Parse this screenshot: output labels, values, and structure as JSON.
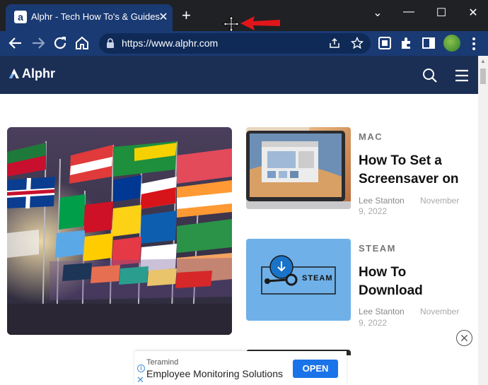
{
  "browser": {
    "tab_title": "Alphr - Tech How To's & Guides",
    "tab_favicon": "a",
    "tab_close": "✕",
    "new_tab": "+",
    "url_host": "https://www.alphr.com",
    "window_controls": {
      "minimize": "—",
      "maximize": "☐",
      "close": "✕",
      "tab_search": "⌄"
    },
    "icons": [
      "back-arrow-icon",
      "forward-arrow-icon",
      "reload-icon",
      "home-icon",
      "lock-icon",
      "share-icon",
      "star-icon",
      "screenshot-icon",
      "extensions-icon",
      "sidepanel-icon",
      "profile-avatar",
      "kebab-menu-icon",
      "move-cursor-icon",
      "red-arrow-annotation"
    ],
    "accent_color": "#1a3a73"
  },
  "site": {
    "logo": "Alphr",
    "header_color": "#1b2f55"
  },
  "articles": [
    {
      "category": "MAC",
      "title_line1": "How To Set a",
      "title_line2": "Screensaver on",
      "author": "Lee Stanton",
      "date_part1": "November",
      "date_part2": "9, 2022"
    },
    {
      "category": "STEAM",
      "title_line1": "How To",
      "title_line2": "Download",
      "author": "Lee Stanton",
      "date_part1": "November",
      "date_part2": "9, 2022",
      "thumb_label": "STEAM"
    }
  ],
  "ad": {
    "brand": "Teramind",
    "title": "Employee Monitoring Solutions",
    "cta": "OPEN",
    "info": "i",
    "close": "✕"
  }
}
